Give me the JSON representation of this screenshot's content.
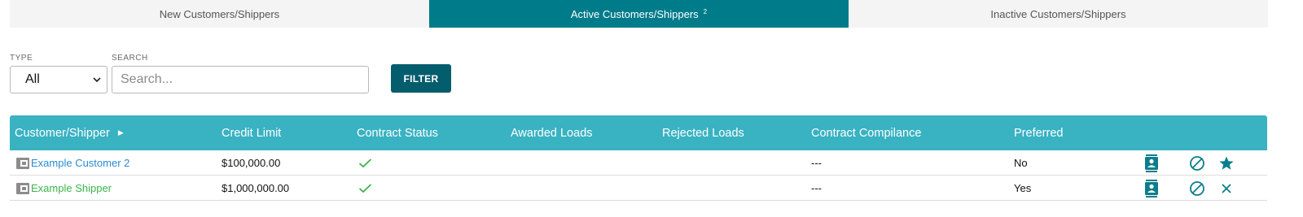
{
  "tabs": [
    {
      "label": "New Customers/Shippers",
      "count": ""
    },
    {
      "label": "Active Customers/Shippers",
      "count": "2"
    },
    {
      "label": "Inactive Customers/Shippers",
      "count": ""
    }
  ],
  "filters": {
    "type_label": "TYPE",
    "type_value": "All",
    "search_label": "SEARCH",
    "search_placeholder": "Search...",
    "filter_button": "FILTER"
  },
  "table": {
    "headers": [
      "Customer/Shipper",
      "Credit Limit",
      "Contract Status",
      "Awarded Loads",
      "Rejected Loads",
      "Contract Compilance",
      "Preferred"
    ],
    "rows": [
      {
        "name": "Example Customer 2",
        "credit_limit": "$100,000.00",
        "contract_status": "check",
        "awarded": "",
        "rejected": "",
        "compliance": "---",
        "preferred": "No",
        "actions": [
          "contact-card-icon",
          "block-icon",
          "star-icon"
        ]
      },
      {
        "name": "Example Shipper",
        "credit_limit": "$1,000,000.00",
        "contract_status": "check",
        "awarded": "",
        "rejected": "",
        "compliance": "---",
        "preferred": "Yes",
        "actions": [
          "contact-card-icon",
          "block-icon",
          "close-icon"
        ]
      }
    ]
  },
  "colors": {
    "tab_active": "#007b8a",
    "header_bg": "#39b2c2",
    "filter_button": "#045d6d",
    "customer_link": "#2a8bd4",
    "shipper_link": "#3bb54a",
    "check": "#3bb54a",
    "action_icon": "#0a7d8c"
  }
}
